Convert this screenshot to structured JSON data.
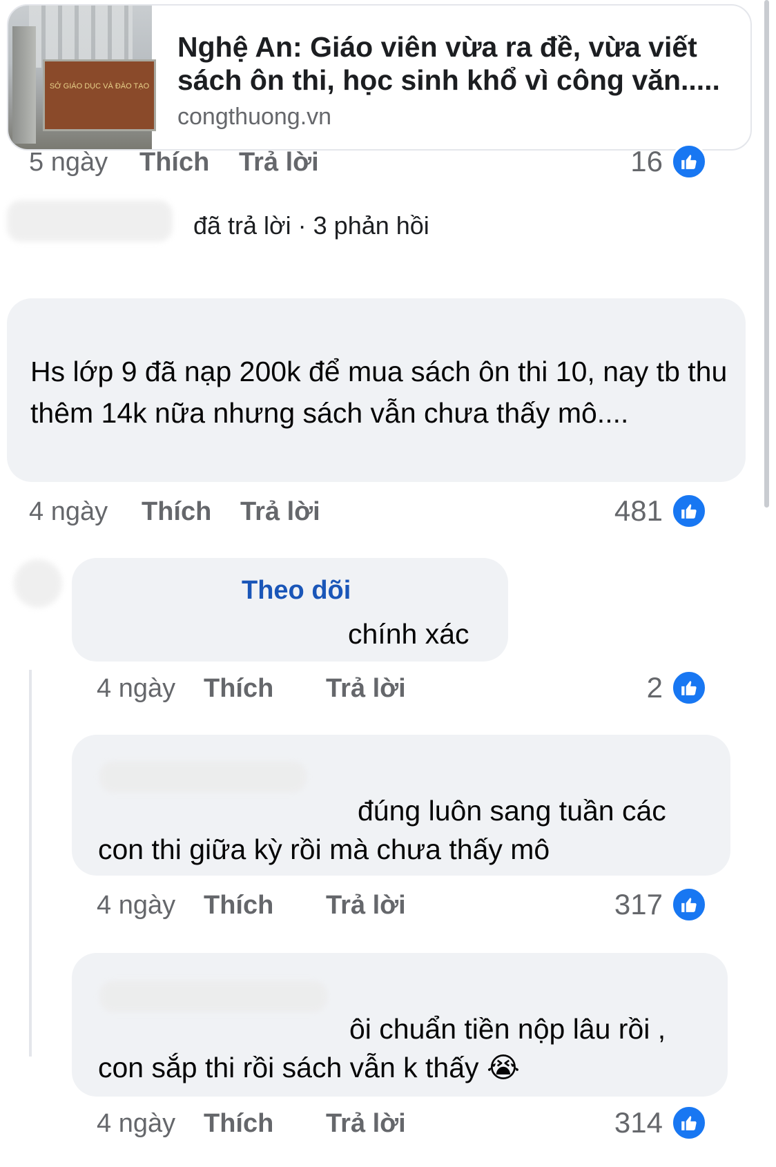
{
  "link_preview": {
    "title": "Nghệ An: Giáo viên vừa ra đề, vừa viết sách ôn thi, học sinh khổ vì công văn.....",
    "domain": "congthuong.vn",
    "thumbnail_sign_text": "SỞ GIÁO DỤC VÀ ĐÀO TẠO"
  },
  "post_actions": {
    "time": "5 ngày",
    "like": "Thích",
    "reply": "Trả lời",
    "reactions": "16"
  },
  "replied_summary": "đã trả lời · 3 phản hồi",
  "comments": [
    {
      "text": "Hs lớp 9 đã nạp 200k để mua sách ôn thi 10, nay tb thu thêm 14k nữa nhưng sách vẫn chưa thấy mô....",
      "time": "4 ngày",
      "like": "Thích",
      "reply": "Trả lời",
      "reactions": "481"
    },
    {
      "follow": "Theo dõi",
      "text": "chính xác",
      "time": "4 ngày",
      "like": "Thích",
      "reply": "Trả lời",
      "reactions": "2"
    },
    {
      "text_line1": "đúng luôn sang tuần các",
      "text_line2": "con thi giữa kỳ rồi mà chưa thấy mô",
      "time": "4 ngày",
      "like": "Thích",
      "reply": "Trả lời",
      "reactions": "317"
    },
    {
      "text_line1": "ôi chuẩn tiền nộp lâu rồi ,",
      "text_line2": "con sắp thi rồi sách vẫn k thấy",
      "emoji": "😭",
      "time": "4 ngày",
      "like": "Thích",
      "reply": "Trả lời",
      "reactions": "314"
    }
  ],
  "icons": {
    "reaction": "like-thumb-icon",
    "reaction_color": "#1877f2",
    "follow_color": "#1a56b8"
  }
}
